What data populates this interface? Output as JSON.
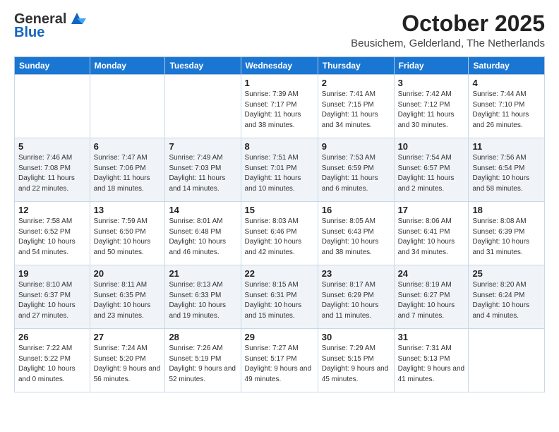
{
  "logo": {
    "line1": "General",
    "line2": "Blue"
  },
  "header": {
    "title": "October 2025",
    "subtitle": "Beusichem, Gelderland, The Netherlands"
  },
  "weekdays": [
    "Sunday",
    "Monday",
    "Tuesday",
    "Wednesday",
    "Thursday",
    "Friday",
    "Saturday"
  ],
  "weeks": [
    [
      {
        "day": "",
        "sunrise": "",
        "sunset": "",
        "daylight": ""
      },
      {
        "day": "",
        "sunrise": "",
        "sunset": "",
        "daylight": ""
      },
      {
        "day": "",
        "sunrise": "",
        "sunset": "",
        "daylight": ""
      },
      {
        "day": "1",
        "sunrise": "Sunrise: 7:39 AM",
        "sunset": "Sunset: 7:17 PM",
        "daylight": "Daylight: 11 hours and 38 minutes."
      },
      {
        "day": "2",
        "sunrise": "Sunrise: 7:41 AM",
        "sunset": "Sunset: 7:15 PM",
        "daylight": "Daylight: 11 hours and 34 minutes."
      },
      {
        "day": "3",
        "sunrise": "Sunrise: 7:42 AM",
        "sunset": "Sunset: 7:12 PM",
        "daylight": "Daylight: 11 hours and 30 minutes."
      },
      {
        "day": "4",
        "sunrise": "Sunrise: 7:44 AM",
        "sunset": "Sunset: 7:10 PM",
        "daylight": "Daylight: 11 hours and 26 minutes."
      }
    ],
    [
      {
        "day": "5",
        "sunrise": "Sunrise: 7:46 AM",
        "sunset": "Sunset: 7:08 PM",
        "daylight": "Daylight: 11 hours and 22 minutes."
      },
      {
        "day": "6",
        "sunrise": "Sunrise: 7:47 AM",
        "sunset": "Sunset: 7:06 PM",
        "daylight": "Daylight: 11 hours and 18 minutes."
      },
      {
        "day": "7",
        "sunrise": "Sunrise: 7:49 AM",
        "sunset": "Sunset: 7:03 PM",
        "daylight": "Daylight: 11 hours and 14 minutes."
      },
      {
        "day": "8",
        "sunrise": "Sunrise: 7:51 AM",
        "sunset": "Sunset: 7:01 PM",
        "daylight": "Daylight: 11 hours and 10 minutes."
      },
      {
        "day": "9",
        "sunrise": "Sunrise: 7:53 AM",
        "sunset": "Sunset: 6:59 PM",
        "daylight": "Daylight: 11 hours and 6 minutes."
      },
      {
        "day": "10",
        "sunrise": "Sunrise: 7:54 AM",
        "sunset": "Sunset: 6:57 PM",
        "daylight": "Daylight: 11 hours and 2 minutes."
      },
      {
        "day": "11",
        "sunrise": "Sunrise: 7:56 AM",
        "sunset": "Sunset: 6:54 PM",
        "daylight": "Daylight: 10 hours and 58 minutes."
      }
    ],
    [
      {
        "day": "12",
        "sunrise": "Sunrise: 7:58 AM",
        "sunset": "Sunset: 6:52 PM",
        "daylight": "Daylight: 10 hours and 54 minutes."
      },
      {
        "day": "13",
        "sunrise": "Sunrise: 7:59 AM",
        "sunset": "Sunset: 6:50 PM",
        "daylight": "Daylight: 10 hours and 50 minutes."
      },
      {
        "day": "14",
        "sunrise": "Sunrise: 8:01 AM",
        "sunset": "Sunset: 6:48 PM",
        "daylight": "Daylight: 10 hours and 46 minutes."
      },
      {
        "day": "15",
        "sunrise": "Sunrise: 8:03 AM",
        "sunset": "Sunset: 6:46 PM",
        "daylight": "Daylight: 10 hours and 42 minutes."
      },
      {
        "day": "16",
        "sunrise": "Sunrise: 8:05 AM",
        "sunset": "Sunset: 6:43 PM",
        "daylight": "Daylight: 10 hours and 38 minutes."
      },
      {
        "day": "17",
        "sunrise": "Sunrise: 8:06 AM",
        "sunset": "Sunset: 6:41 PM",
        "daylight": "Daylight: 10 hours and 34 minutes."
      },
      {
        "day": "18",
        "sunrise": "Sunrise: 8:08 AM",
        "sunset": "Sunset: 6:39 PM",
        "daylight": "Daylight: 10 hours and 31 minutes."
      }
    ],
    [
      {
        "day": "19",
        "sunrise": "Sunrise: 8:10 AM",
        "sunset": "Sunset: 6:37 PM",
        "daylight": "Daylight: 10 hours and 27 minutes."
      },
      {
        "day": "20",
        "sunrise": "Sunrise: 8:11 AM",
        "sunset": "Sunset: 6:35 PM",
        "daylight": "Daylight: 10 hours and 23 minutes."
      },
      {
        "day": "21",
        "sunrise": "Sunrise: 8:13 AM",
        "sunset": "Sunset: 6:33 PM",
        "daylight": "Daylight: 10 hours and 19 minutes."
      },
      {
        "day": "22",
        "sunrise": "Sunrise: 8:15 AM",
        "sunset": "Sunset: 6:31 PM",
        "daylight": "Daylight: 10 hours and 15 minutes."
      },
      {
        "day": "23",
        "sunrise": "Sunrise: 8:17 AM",
        "sunset": "Sunset: 6:29 PM",
        "daylight": "Daylight: 10 hours and 11 minutes."
      },
      {
        "day": "24",
        "sunrise": "Sunrise: 8:19 AM",
        "sunset": "Sunset: 6:27 PM",
        "daylight": "Daylight: 10 hours and 7 minutes."
      },
      {
        "day": "25",
        "sunrise": "Sunrise: 8:20 AM",
        "sunset": "Sunset: 6:24 PM",
        "daylight": "Daylight: 10 hours and 4 minutes."
      }
    ],
    [
      {
        "day": "26",
        "sunrise": "Sunrise: 7:22 AM",
        "sunset": "Sunset: 5:22 PM",
        "daylight": "Daylight: 10 hours and 0 minutes."
      },
      {
        "day": "27",
        "sunrise": "Sunrise: 7:24 AM",
        "sunset": "Sunset: 5:20 PM",
        "daylight": "Daylight: 9 hours and 56 minutes."
      },
      {
        "day": "28",
        "sunrise": "Sunrise: 7:26 AM",
        "sunset": "Sunset: 5:19 PM",
        "daylight": "Daylight: 9 hours and 52 minutes."
      },
      {
        "day": "29",
        "sunrise": "Sunrise: 7:27 AM",
        "sunset": "Sunset: 5:17 PM",
        "daylight": "Daylight: 9 hours and 49 minutes."
      },
      {
        "day": "30",
        "sunrise": "Sunrise: 7:29 AM",
        "sunset": "Sunset: 5:15 PM",
        "daylight": "Daylight: 9 hours and 45 minutes."
      },
      {
        "day": "31",
        "sunrise": "Sunrise: 7:31 AM",
        "sunset": "Sunset: 5:13 PM",
        "daylight": "Daylight: 9 hours and 41 minutes."
      },
      {
        "day": "",
        "sunrise": "",
        "sunset": "",
        "daylight": ""
      }
    ]
  ]
}
